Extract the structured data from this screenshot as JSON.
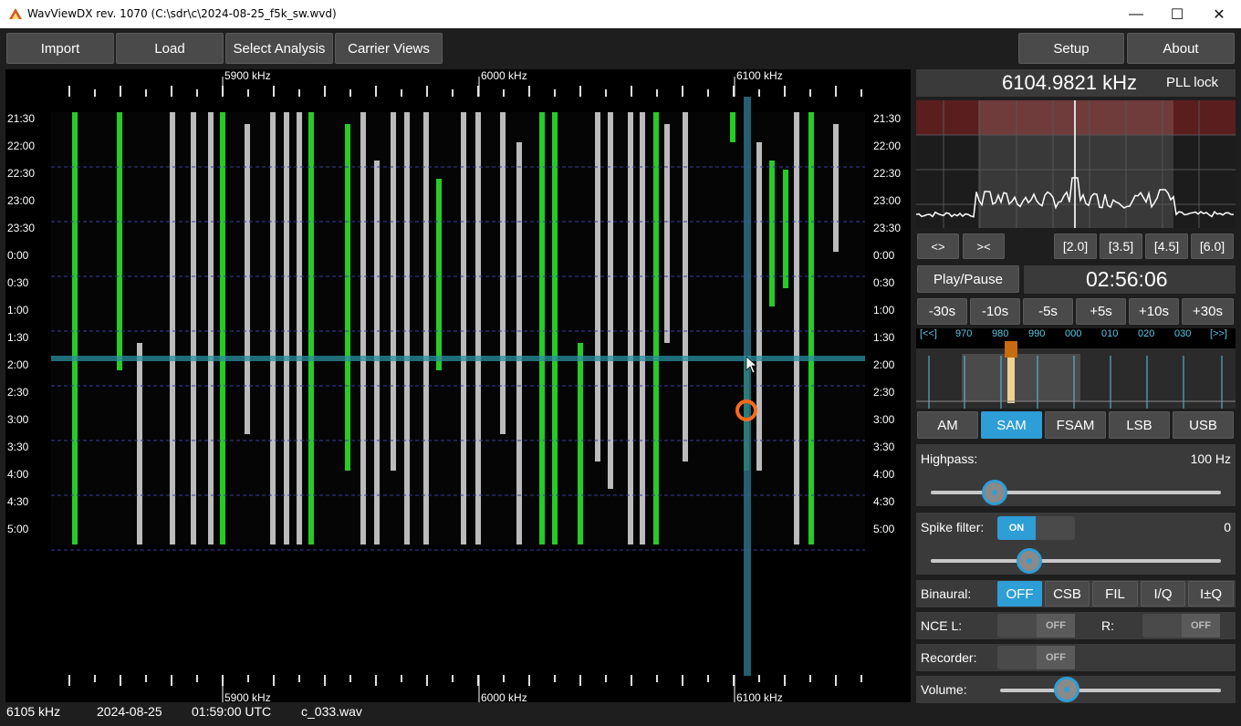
{
  "window": {
    "title": "WavViewDX rev. 1070 (C:\\sdr\\c\\2024-08-25_f5k_sw.wvd)",
    "minimize": "—",
    "maximize": "☐",
    "close": "✕"
  },
  "toolbar": {
    "import": "Import",
    "load": "Load",
    "select_analysis": "Select Analysis",
    "carrier_views": "Carrier Views",
    "setup": "Setup",
    "about": "About"
  },
  "waterfall": {
    "freq_top": [
      "5900 kHz",
      "6000 kHz",
      "6100 kHz"
    ],
    "freq_bottom": [
      "5900 kHz",
      "6000 kHz",
      "6100 kHz"
    ],
    "times": [
      "21:30",
      "22:00",
      "22:30",
      "23:00",
      "23:30",
      "0:00",
      "0:30",
      "1:00",
      "1:30",
      "2:00",
      "2:30",
      "3:00",
      "3:30",
      "4:00",
      "4:30",
      "5:00"
    ]
  },
  "receiver": {
    "frequency": "6104.9821 kHz",
    "pll": "PLL lock",
    "widen": "<>",
    "narrow": "><",
    "bw": [
      "[2.0]",
      "[3.5]",
      "[4.5]",
      "[6.0]"
    ],
    "play_pause": "Play/Pause",
    "clock": "02:56:06",
    "seek": [
      "-30s",
      "-10s",
      "-5s",
      "+5s",
      "+10s",
      "+30s"
    ],
    "scale_prev": "[<<]",
    "scale_next": "[>>]",
    "scale_ticks": [
      "970",
      "980",
      "990",
      "000",
      "010",
      "020",
      "030"
    ],
    "modes": [
      "AM",
      "SAM",
      "FSAM",
      "LSB",
      "USB"
    ],
    "active_mode": "SAM"
  },
  "filters": {
    "highpass_label": "Highpass:",
    "highpass_value": "100 Hz",
    "highpass_level": 0.22,
    "spike_label": "Spike filter:",
    "spike_toggle": "ON",
    "spike_value": "0",
    "spike_level": 0.34,
    "binaural_label": "Binaural:",
    "binaural_options": [
      "OFF",
      "CSB",
      "FIL",
      "I/Q",
      "I±Q"
    ],
    "binaural_active": "OFF",
    "nce_label": "NCE L:",
    "nce_l_state": "OFF",
    "nce_r_label": "R:",
    "nce_r_state": "OFF",
    "recorder_label": "Recorder:",
    "recorder_state": "OFF",
    "volume_label": "Volume:",
    "volume_level": 0.3
  },
  "statusbar": {
    "freq": "6105 kHz",
    "date": "2024-08-25",
    "time": "01:59:00 UTC",
    "file": "c_033.wav"
  }
}
